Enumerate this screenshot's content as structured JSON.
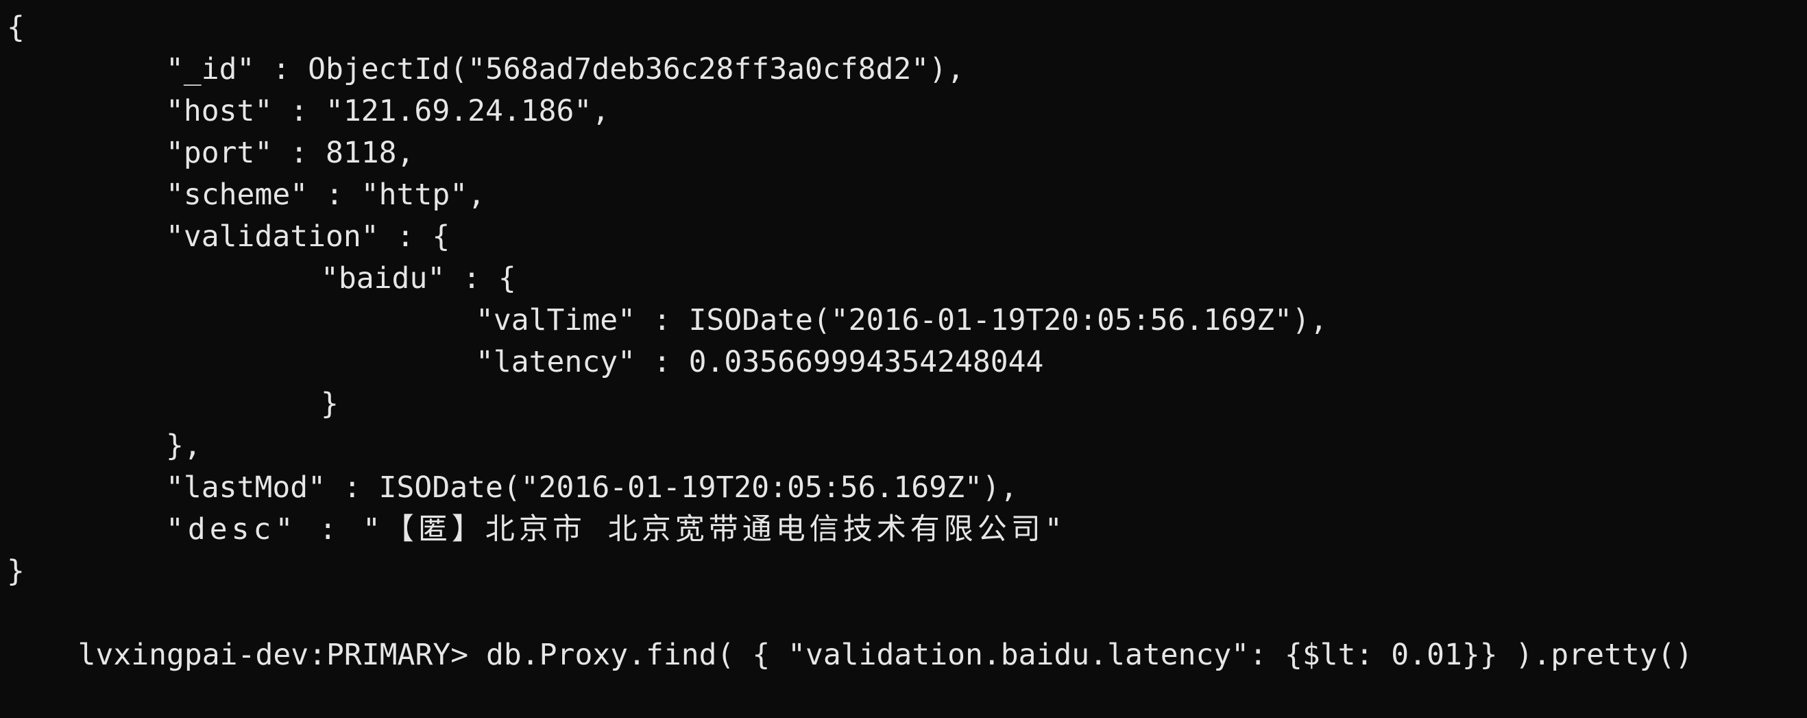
{
  "terminal": {
    "lines": [
      {
        "indent": 0,
        "text": "{"
      },
      {
        "indent": 1,
        "text": "\"_id\" : ObjectId(\"568ad7deb36c28ff3a0cf8d2\"),"
      },
      {
        "indent": 1,
        "text": "\"host\" : \"121.69.24.186\","
      },
      {
        "indent": 1,
        "text": "\"port\" : 8118,"
      },
      {
        "indent": 1,
        "text": "\"scheme\" : \"http\","
      },
      {
        "indent": 1,
        "text": "\"validation\" : {"
      },
      {
        "indent": 2,
        "text": "\"baidu\" : {"
      },
      {
        "indent": 3,
        "text": "\"valTime\" : ISODate(\"2016-01-19T20:05:56.169Z\"),"
      },
      {
        "indent": 3,
        "text": "\"latency\" : 0.035669994354248044"
      },
      {
        "indent": 2,
        "text": "}"
      },
      {
        "indent": 1,
        "text": "},"
      },
      {
        "indent": 1,
        "text": "\"lastMod\" : ISODate(\"2016-01-19T20:05:56.169Z\"),"
      },
      {
        "indent": 1,
        "text": "\"desc\" : \"【匿】北京市 北京宽带通电信技术有限公司\""
      },
      {
        "indent": 0,
        "text": "}"
      }
    ],
    "prompt": "lvxingpai-dev:PRIMARY> ",
    "command": "db.Proxy.find( { \"validation.baidu.latency\": {$lt: 0.01}} ).pretty()"
  }
}
